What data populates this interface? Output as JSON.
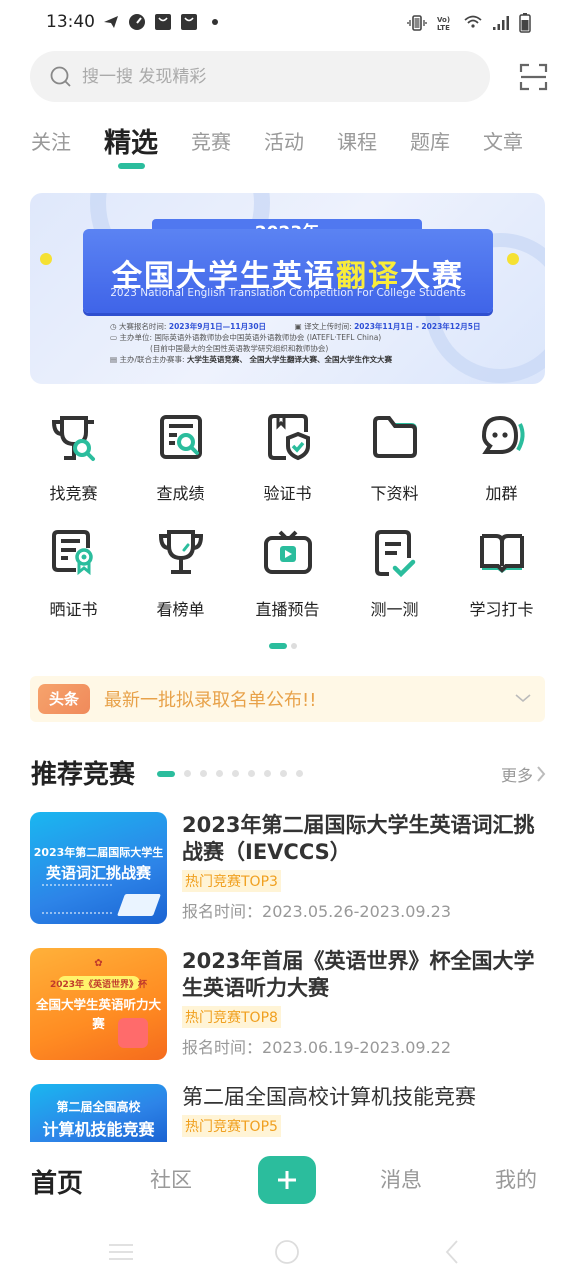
{
  "status_bar": {
    "time": "13:40",
    "left_icons": [
      "telegram-icon",
      "speedometer-icon",
      "shopping-bag-icon",
      "shopping-bag-icon",
      "dot-icon"
    ],
    "right_icons": [
      "vibrate-icon",
      "volte-icon",
      "wifi-icon",
      "signal-icon",
      "battery-icon"
    ],
    "volte_label": "Vo) LTE"
  },
  "search": {
    "placeholder": "搜一搜 发现精彩",
    "scan_icon": "scan-icon"
  },
  "tabs": [
    {
      "label": "关注",
      "active": false
    },
    {
      "label": "精选",
      "active": true
    },
    {
      "label": "竞赛",
      "active": false
    },
    {
      "label": "活动",
      "active": false
    },
    {
      "label": "课程",
      "active": false
    },
    {
      "label": "题库",
      "active": false
    },
    {
      "label": "文章",
      "active": false
    }
  ],
  "banner": {
    "year": "—— 2023年 ——",
    "title_a": "全国大学生英语",
    "title_highlight": "翻译",
    "title_b": "大赛",
    "subtitle": "2023 National  English Translation Competition For College Students",
    "info": {
      "reg_label": "大赛报名时间:",
      "reg_value": "2023年9月1日—11月30日",
      "upload_label": "译文上传时间:",
      "upload_value": "2023年11月1日 - 2023年12月5日",
      "org_label": "主办单位:",
      "org_value": "国际英语外语教师协会中国英语外语教师协会 (IATEFL·TEFL China)",
      "org_note": "(目前中国最大的全国性英语教学研究组织和教师协会)",
      "co_label": "主办/联合主办赛事:",
      "co_value": "大学生英语竞赛、 全国大学生翻译大赛、全国大学生作文大赛"
    }
  },
  "quick_grid": {
    "rows": [
      [
        {
          "label": "找竞赛",
          "icon": "trophy-search-icon"
        },
        {
          "label": "查成绩",
          "icon": "document-search-icon"
        },
        {
          "label": "验证书",
          "icon": "certificate-shield-icon"
        },
        {
          "label": "下资料",
          "icon": "folder-icon"
        },
        {
          "label": "加群",
          "icon": "chat-bubble-icon"
        }
      ],
      [
        {
          "label": "晒证书",
          "icon": "certificate-ribbon-icon"
        },
        {
          "label": "看榜单",
          "icon": "trophy-icon"
        },
        {
          "label": "直播预告",
          "icon": "tv-play-icon"
        },
        {
          "label": "测一测",
          "icon": "document-check-icon"
        },
        {
          "label": "学习打卡",
          "icon": "open-book-icon"
        }
      ]
    ],
    "page": 1,
    "page_count": 2
  },
  "notice": {
    "badge": "头条",
    "text": "最新一批拟录取名单公布!!"
  },
  "recommend": {
    "title": "推荐竞赛",
    "more_label": "更多",
    "page": 1,
    "page_count": 9,
    "items": [
      {
        "title": "2023年第二届国际大学生英语词汇挑战赛（IEVCCS）",
        "tag": "热门竞赛TOP3",
        "date_label": "报名时间：",
        "date_value": "2023.05.26-2023.09.23",
        "thumb_line1": "2023年第二届国际大学生",
        "thumb_line2": "英语词汇挑战赛"
      },
      {
        "title": "2023年首届《英语世界》杯全国大学生英语听力大赛",
        "tag": "热门竞赛TOP8",
        "date_label": "报名时间：",
        "date_value": "2023.06.19-2023.09.22",
        "thumb_line1": "2023年《英语世界》杯",
        "thumb_line2": "全国大学生英语听力大赛"
      },
      {
        "title": "第二届全国高校计算机技能竞赛",
        "tag": "热门竞赛TOP5",
        "thumb_line1": "第二届全国高校",
        "thumb_line2": "计算机技能竞赛"
      }
    ]
  },
  "bottom_nav": {
    "items": [
      {
        "label": "首页",
        "active": true
      },
      {
        "label": "社区",
        "active": false
      },
      {
        "label": "消息",
        "active": false
      },
      {
        "label": "我的",
        "active": false
      }
    ],
    "plus_icon": "plus-icon"
  },
  "colors": {
    "accent": "#2bbd9d",
    "notice_bg": "#fff8e6",
    "notice_text": "#e8a24a",
    "tag_text": "#f0a020"
  }
}
